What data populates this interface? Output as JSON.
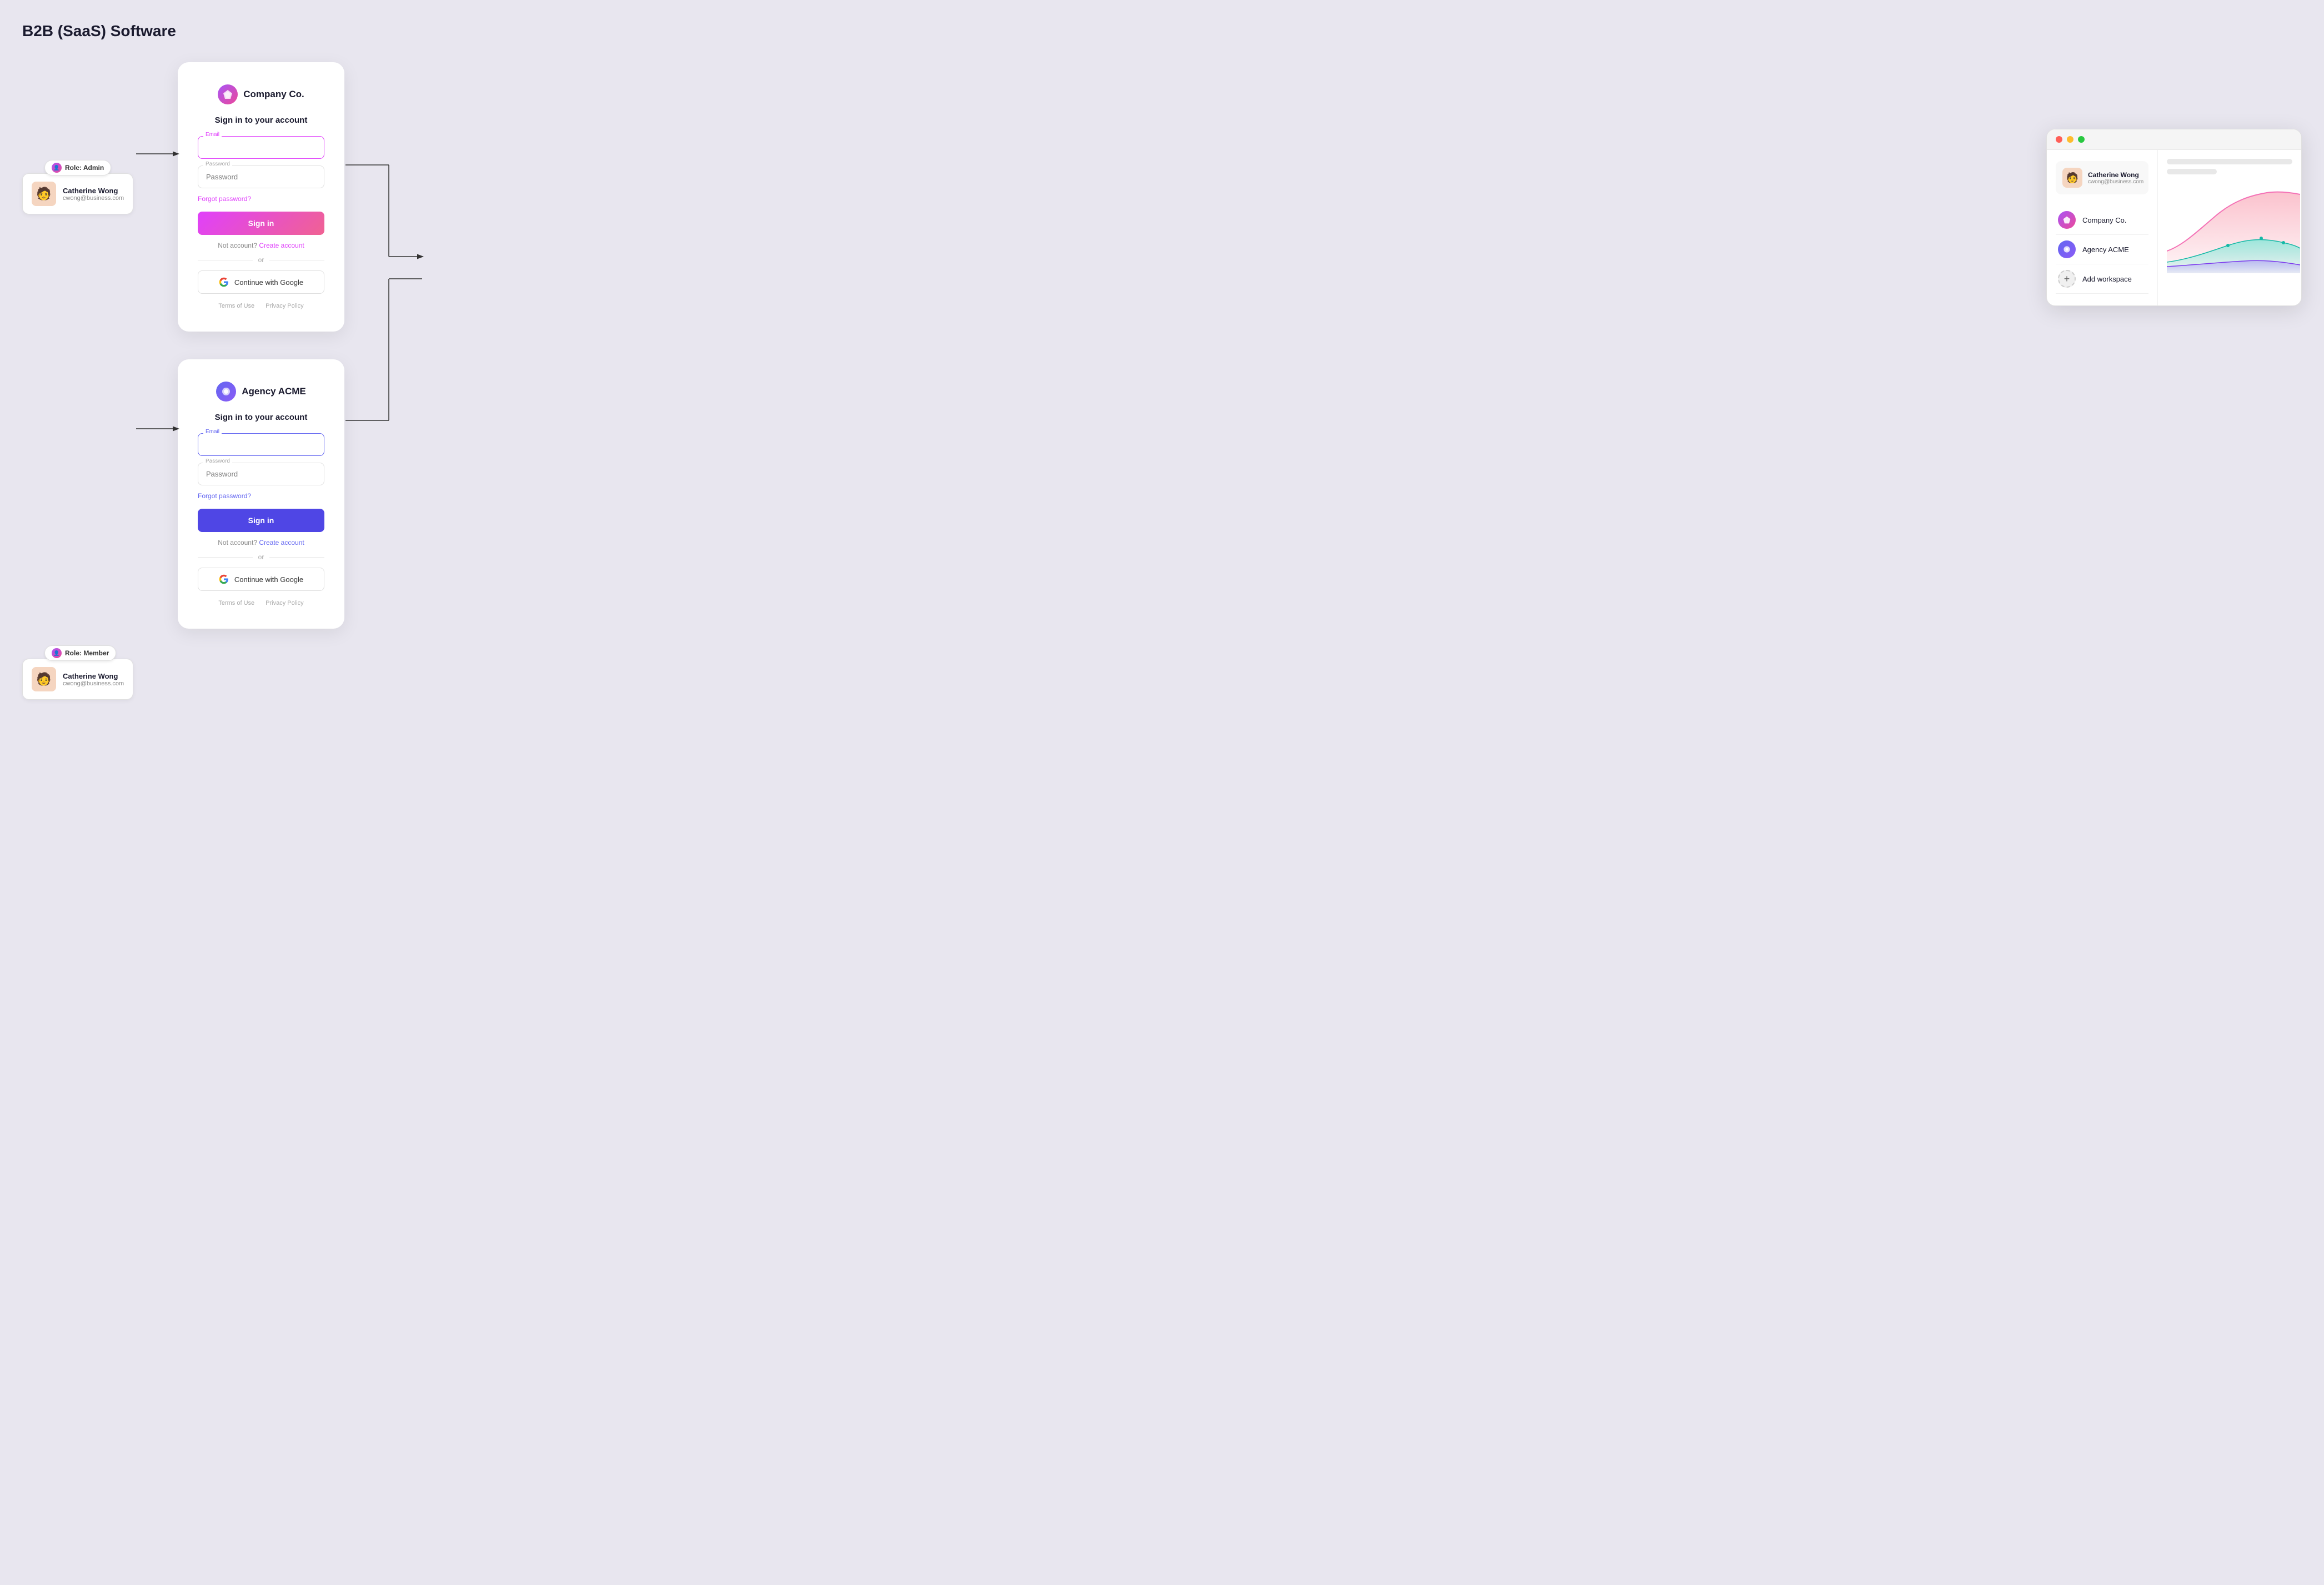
{
  "page": {
    "title": "B2B (SaaS) Software"
  },
  "user": {
    "name": "Catherine Wong",
    "email": "cwong@business.com",
    "avatar": "🧑"
  },
  "user_card_1": {
    "role_label": "Role: Admin",
    "name": "Catherine Wong",
    "email": "cwong@business.com"
  },
  "user_card_2": {
    "role_label": "Role: Member",
    "name": "Catherine Wong",
    "email": "cwong@business.com"
  },
  "login_form_1": {
    "logo_text": "Company Co.",
    "title": "Sign in to your account",
    "email_label": "Email",
    "email_placeholder": "",
    "password_placeholder": "Password",
    "forgot_text": "Forgot password?",
    "signin_label": "Sign in",
    "not_account_text": "Not account?",
    "create_account_text": "Create account",
    "or_text": "or",
    "google_button_label": "Continue with Google",
    "terms_label": "Terms of Use",
    "privacy_label": "Privacy Policy"
  },
  "login_form_2": {
    "logo_text": "Agency ACME",
    "title": "Sign in to your account",
    "email_label": "Email",
    "email_placeholder": "",
    "password_placeholder": "Password",
    "forgot_text": "Forgot password?",
    "signin_label": "Sign in",
    "not_account_text": "Not account?",
    "create_account_text": "Create account",
    "or_text": "or",
    "google_button_label": "Continue with Google",
    "terms_label": "Terms of Use",
    "privacy_label": "Privacy Policy"
  },
  "app_mockup": {
    "profile_name": "Catherine Wong",
    "profile_email": "cwong@business.com",
    "workspace_1": "Company Co.",
    "workspace_2": "Agency ACME",
    "add_workspace": "Add workspace"
  }
}
